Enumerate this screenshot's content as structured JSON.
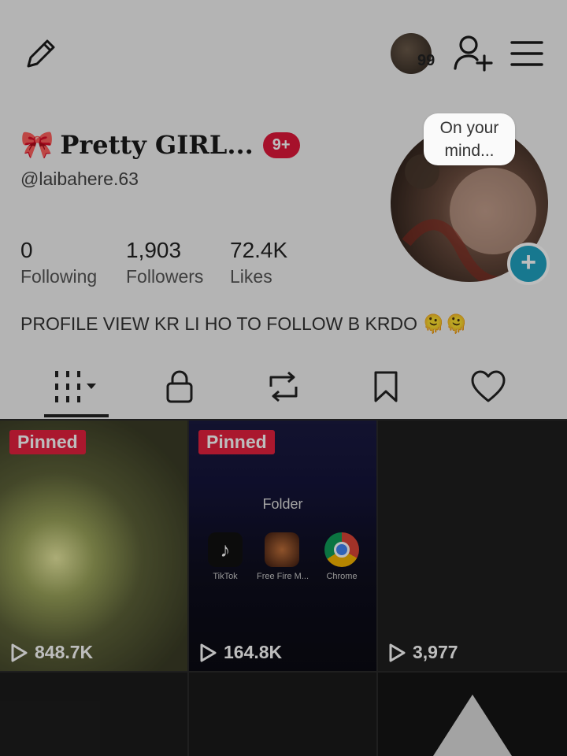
{
  "header": {
    "avatar_badge": "99"
  },
  "profile": {
    "display_name": "Pretty GIRL...",
    "notification_badge": "9+",
    "username": "@laibahere.63",
    "bubble_text_1": "On your",
    "bubble_text_2": "mind...",
    "stats": {
      "following_count": "0",
      "following_label": "Following",
      "followers_count": "1,903",
      "followers_label": "Followers",
      "likes_count": "72.4K",
      "likes_label": "Likes"
    },
    "bio": "PROFILE VIEW KR LI HO TO FOLLOW B KRDO"
  },
  "tabs": [
    {
      "icon": "grid-icon",
      "active": true
    },
    {
      "icon": "lock-icon"
    },
    {
      "icon": "repost-icon"
    },
    {
      "icon": "bookmark-icon"
    },
    {
      "icon": "heart-icon"
    }
  ],
  "videos": [
    {
      "pinned_label": "Pinned",
      "views": "848.7K"
    },
    {
      "pinned_label": "Pinned",
      "views": "164.8K",
      "folder_title": "Folder",
      "apps": [
        "TikTok",
        "Free Fire M...",
        "Chrome"
      ]
    },
    {
      "views": "3,977"
    }
  ],
  "colors": {
    "accent_red": "#e6213f",
    "plus_button": "#1fa3c2"
  }
}
